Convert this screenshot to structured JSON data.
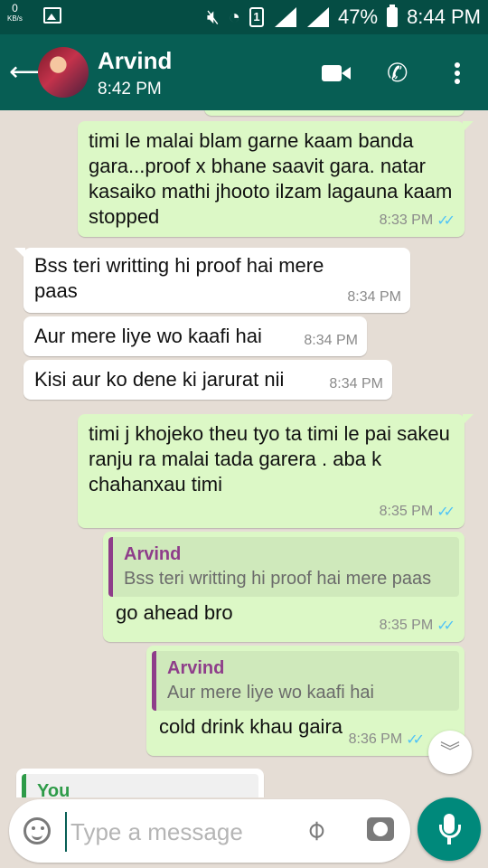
{
  "statusbar": {
    "net_speed": "0",
    "net_unit": "KB/s",
    "sim": "1",
    "battery": "47%",
    "time": "8:44 PM"
  },
  "header": {
    "back_icon": "arrow-left-icon",
    "contact_name": "Arvind",
    "last_seen": "8:42 PM",
    "icons": [
      "video-call-icon",
      "phone-icon",
      "more-vert-icon"
    ]
  },
  "messages": [
    {
      "dir": "out",
      "text": "timi le malai blam garne kaam banda gara...proof x bhane saavit gara. natar kasaiko mathi jhooto ilzam lagauna kaam stopped",
      "time": "8:33 PM",
      "ticks": "✓✓"
    },
    {
      "dir": "in",
      "text": "Bss teri writting hi proof hai mere paas",
      "time": "8:34 PM"
    },
    {
      "dir": "in",
      "text": "Aur mere liye wo kaafi hai",
      "time": "8:34 PM"
    },
    {
      "dir": "in",
      "text": "Kisi aur ko dene ki jarurat nii",
      "time": "8:34 PM"
    },
    {
      "dir": "out",
      "text": "timi j khojeko theu tyo ta timi le pai sakeu\nranju ra malai tada garera . aba k chahanxau timi",
      "time": "8:35 PM",
      "ticks": "✓✓"
    },
    {
      "dir": "out",
      "quote_name": "Arvind",
      "quote_text": "Bss teri writting hi proof hai mere paas",
      "text": "go ahead bro",
      "time": "8:35 PM",
      "ticks": "✓✓"
    },
    {
      "dir": "out",
      "quote_name": "Arvind",
      "quote_text": "Aur mere liye wo kaafi hai",
      "text": "cold drink khau gaira",
      "time": "8:36 PM",
      "ticks": "✓✓"
    },
    {
      "dir": "in",
      "quote_name": "You"
    }
  ],
  "input": {
    "placeholder": "Type a message",
    "icons": [
      "emoji-icon",
      "attach-icon",
      "camera-icon",
      "mic-icon"
    ]
  },
  "colors": {
    "header": "#075e54",
    "statusbar": "#054d44",
    "outgoing_bubble": "#dcf8c6",
    "incoming_bubble": "#ffffff",
    "read_ticks": "#4fc3f7"
  }
}
